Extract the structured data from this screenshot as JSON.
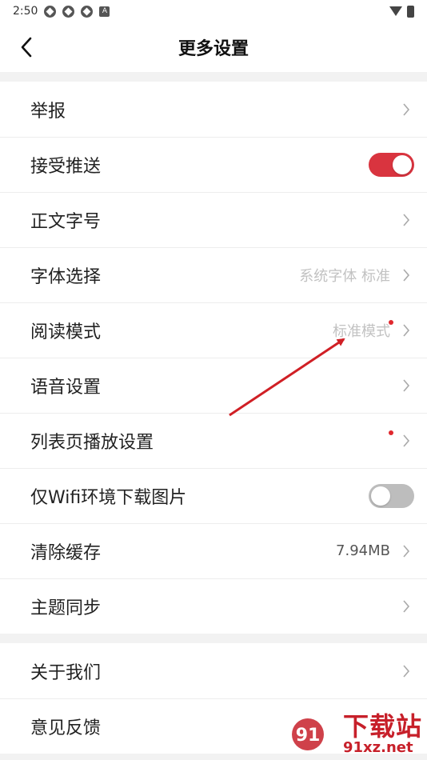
{
  "status_bar": {
    "time": "2:50",
    "a_badge": "A"
  },
  "header": {
    "title": "更多设置"
  },
  "group1": [
    {
      "label": "举报",
      "value": ""
    },
    {
      "label": "接受推送",
      "toggle": "on"
    },
    {
      "label": "正文字号",
      "value": ""
    },
    {
      "label": "字体选择",
      "value": "系统字体 标准"
    },
    {
      "label": "阅读模式",
      "value": "标准模式"
    },
    {
      "label": "语音设置",
      "value": ""
    },
    {
      "label": "列表页播放设置",
      "value": ""
    },
    {
      "label": "仅Wifi环境下载图片",
      "toggle": "off"
    },
    {
      "label": "清除缓存",
      "value": "7.94MB"
    },
    {
      "label": "主题同步",
      "value": ""
    }
  ],
  "group2": [
    {
      "label": "关于我们",
      "value": ""
    },
    {
      "label": "意见反馈",
      "value": ""
    }
  ],
  "watermark": {
    "main": "下载站",
    "sub": "91xz.net",
    "logo_text": "91"
  },
  "colors": {
    "accent": "#d9343f",
    "toggle_off": "#bdbdbd",
    "dot": "#e0282e",
    "arrow": "#d01f25"
  }
}
